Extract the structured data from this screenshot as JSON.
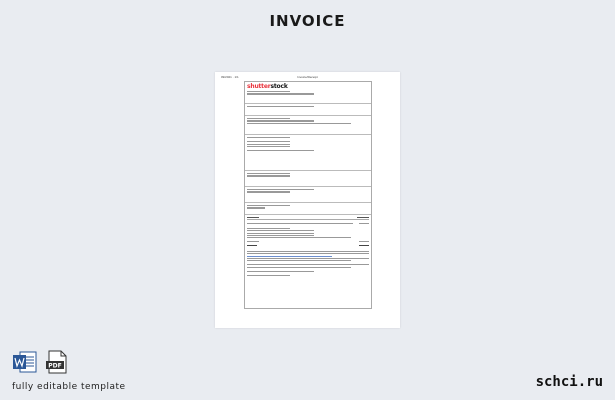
{
  "header": {
    "title": "INVOICE"
  },
  "preview": {
    "top_left": "09/2021 · 1/1",
    "top_center": "Invoice/Receipt",
    "logo": {
      "part1": "shutter",
      "part2": "st",
      "part3": "ck"
    }
  },
  "footer": {
    "caption": "fully editable template",
    "word_icon": "word-doc-icon",
    "pdf_icon": "pdf-doc-icon",
    "pdf_label": "PDF",
    "site": "schci.ru"
  },
  "colors": {
    "background": "#e9ecf1",
    "logo_red": "#e8333c",
    "word_blue": "#2b5797"
  }
}
